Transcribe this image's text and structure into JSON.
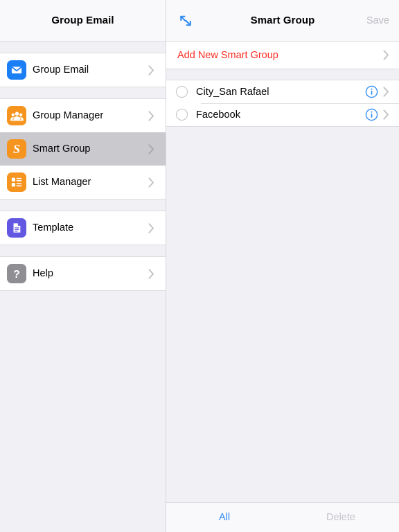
{
  "sidebar": {
    "header": {
      "title": "Group Email"
    },
    "groups": [
      {
        "items": [
          {
            "label": "Group Email",
            "icon": "envelope-icon",
            "icon_color": "#1a7ef5",
            "selected": false
          }
        ]
      },
      {
        "items": [
          {
            "label": "Group Manager",
            "icon": "people-group-icon",
            "icon_color": "#f5941e",
            "selected": false
          },
          {
            "label": "Smart Group",
            "icon": "smart-s-icon",
            "icon_color": "#f5941e",
            "selected": true
          },
          {
            "label": "List Manager",
            "icon": "list-icon",
            "icon_color": "#f5941e",
            "selected": false
          }
        ]
      },
      {
        "items": [
          {
            "label": "Template",
            "icon": "document-icon",
            "icon_color": "#6257e0",
            "selected": false
          }
        ]
      },
      {
        "items": [
          {
            "label": "Help",
            "icon": "question-mark-icon",
            "icon_color": "#8e8e93",
            "selected": false
          }
        ]
      }
    ]
  },
  "detail": {
    "header": {
      "expand_icon": "expand-diagonal-arrows-icon",
      "title": "Smart Group",
      "save_label": "Save"
    },
    "add_row": {
      "label": "Add New Smart Group"
    },
    "items": [
      {
        "label": "City_San Rafael",
        "selected": false,
        "info_icon": "info-circle-icon"
      },
      {
        "label": "Facebook",
        "selected": false,
        "info_icon": "info-circle-icon"
      }
    ],
    "toolbar": {
      "all_label": "All",
      "delete_label": "Delete"
    }
  },
  "colors": {
    "accent_blue": "#2f8af5",
    "destructive_red": "#fb2b20",
    "orange": "#f5941e",
    "purple": "#6257e0",
    "gray": "#8e8e93",
    "selected_row": "#c9c9ce",
    "panel_bg": "#f0f0f5"
  }
}
